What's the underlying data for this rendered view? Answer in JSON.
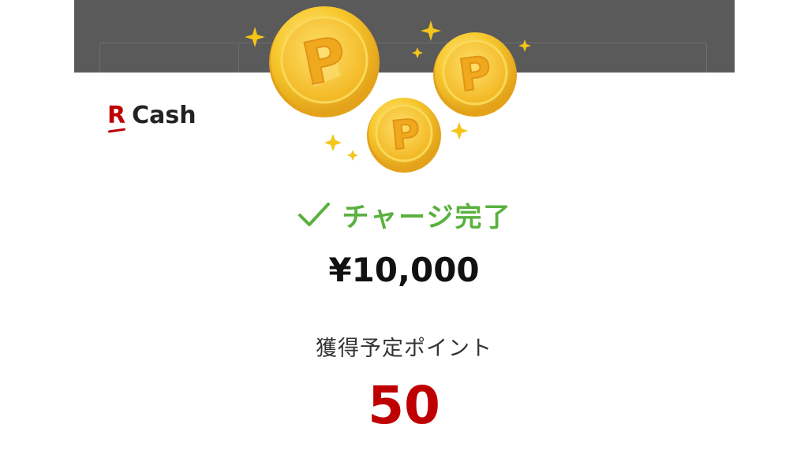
{
  "logo": {
    "mark": "R",
    "text": "Cash"
  },
  "illustration": {
    "coin_letter": "P",
    "coin_count": 3,
    "icon": "coins-sparkle-icon"
  },
  "status": {
    "icon": "check-icon",
    "text": "チャージ完了"
  },
  "charge": {
    "amount": "¥10,000"
  },
  "points": {
    "label": "獲得予定ポイント",
    "value": "50"
  },
  "colors": {
    "brand_red": "#bf0000",
    "success_green": "#5ab13e",
    "coin_gold": "#f5c518",
    "header_gray": "#5a5a5a"
  }
}
